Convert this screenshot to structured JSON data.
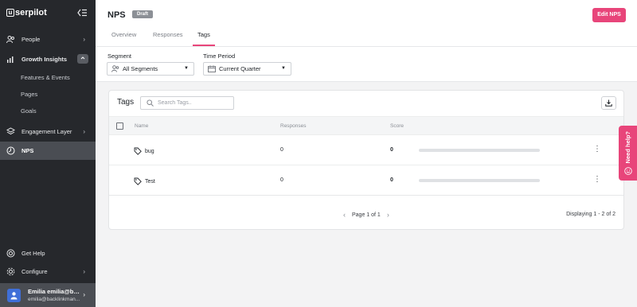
{
  "app": {
    "logo_text": "serpilot",
    "logo_mark": "u"
  },
  "sidebar": {
    "items": [
      {
        "label": "People",
        "icon": "people-icon"
      },
      {
        "label": "Growth Insights",
        "icon": "bar-chart-icon"
      },
      {
        "label": "Engagement Layer",
        "icon": "layers-icon"
      },
      {
        "label": "NPS",
        "icon": "nps-icon"
      }
    ],
    "subitems": [
      "Features & Events",
      "Pages",
      "Goals"
    ],
    "bottom": [
      {
        "label": "Get Help",
        "icon": "lifebuoy-icon"
      },
      {
        "label": "Configure",
        "icon": "gear-icon"
      }
    ],
    "user": {
      "name": "Emilia emilia@bac...",
      "email": "emilia@backlinkman..."
    }
  },
  "header": {
    "title": "NPS",
    "status": "Draft",
    "edit_label": "Edit NPS",
    "tabs": [
      "Overview",
      "Responses",
      "Tags"
    ],
    "active_tab": "Tags"
  },
  "filters": {
    "segment": {
      "label": "Segment",
      "value": "All Segments"
    },
    "period": {
      "label": "Time Period",
      "value": "Current Quarter"
    }
  },
  "tags": {
    "title": "Tags",
    "search_placeholder": "Search Tags..",
    "columns": [
      "Name",
      "Responses",
      "Score"
    ],
    "rows": [
      {
        "name": "bug",
        "responses": "0",
        "score": "0",
        "score_fraction": 0
      },
      {
        "name": "Test",
        "responses": "0",
        "score": "0",
        "score_fraction": 0
      }
    ],
    "pager": "Page 1 of 1",
    "displaying": "Displaying 1 - 2 of 2"
  },
  "help": {
    "label": "Need help?"
  },
  "colors": {
    "accent": "#e8457a",
    "sidebar": "#26282c",
    "active": "#4a4d53"
  }
}
